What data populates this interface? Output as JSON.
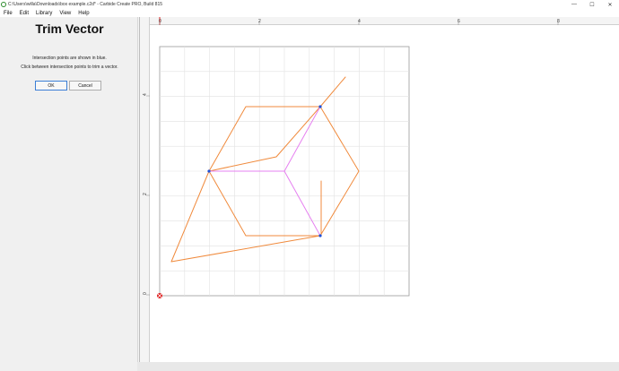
{
  "window": {
    "title": "C:\\Users\\willa\\Downloads\\box example.c2d* - Carbide Create PRO, Build 815",
    "controls": [
      "—",
      "☐",
      "✕"
    ]
  },
  "menu": {
    "items": [
      "File",
      "Edit",
      "Library",
      "View",
      "Help"
    ]
  },
  "panel": {
    "title": "Trim Vector",
    "line1": "Intersection points are shown in blue.",
    "line2": "Click between intersection points to trim a vector.",
    "ok_label": "OK",
    "cancel_label": "Cancel"
  },
  "ruler": {
    "h_labels": [
      "0",
      "2",
      "4",
      "6",
      "8"
    ],
    "v_labels": [
      "4",
      "2",
      "0"
    ]
  },
  "colors": {
    "vector": "#f08a3c",
    "selected_vector": "#e680f0",
    "intersection": "#1f4fd6",
    "grid": "#e2e2e2",
    "origin_mark": "#e02020"
  }
}
